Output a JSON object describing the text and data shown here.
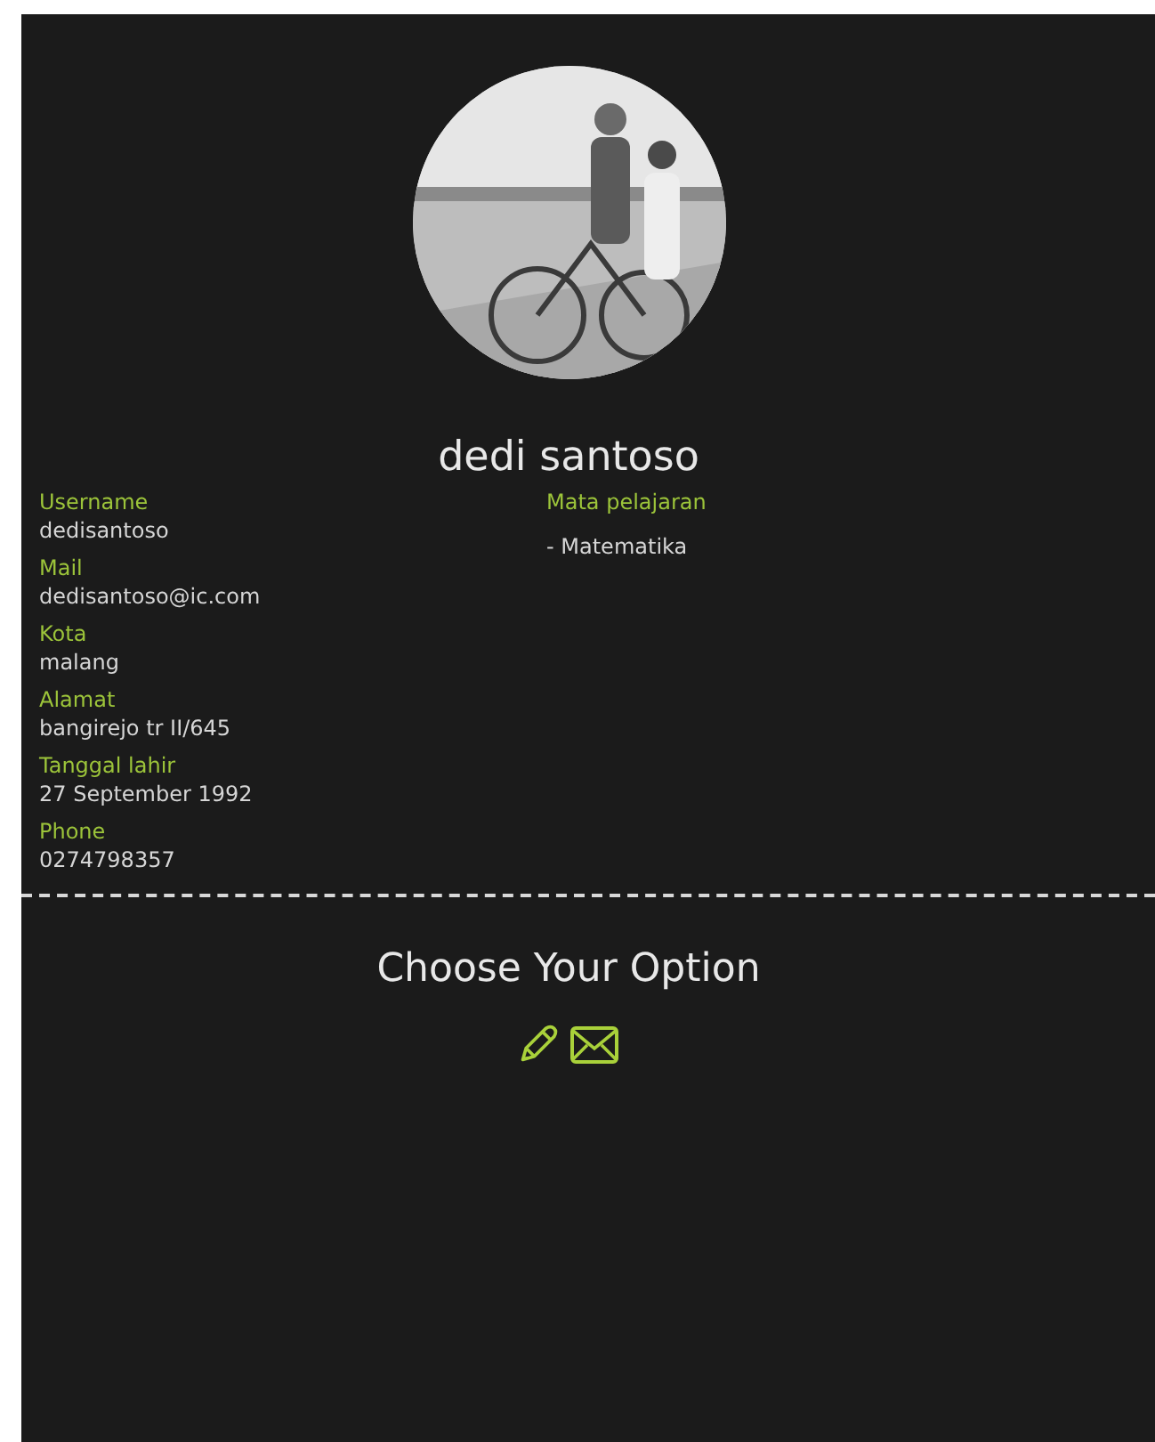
{
  "profile": {
    "name": "dedi santoso"
  },
  "details": [
    {
      "label": "Username",
      "value": "dedisantoso"
    },
    {
      "label": "Mail",
      "value": "dedisantoso@ic.com"
    },
    {
      "label": "Kota",
      "value": "malang"
    },
    {
      "label": "Alamat",
      "value": "bangirejo tr II/645"
    },
    {
      "label": "Tanggal lahir",
      "value": "27 September 1992"
    },
    {
      "label": "Phone",
      "value": "0274798357"
    }
  ],
  "subjects": {
    "label": "Mata pelajaran",
    "items": [
      "- Matematika"
    ]
  },
  "options": {
    "title": "Choose Your Option",
    "actions": [
      {
        "kind": "edit"
      },
      {
        "kind": "mail"
      }
    ]
  }
}
